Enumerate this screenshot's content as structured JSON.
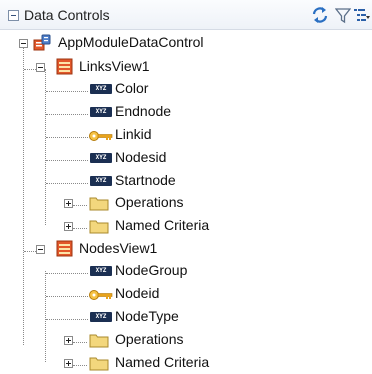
{
  "panel": {
    "title": "Data Controls",
    "toolbar": [
      {
        "name": "refresh-icon",
        "color": "#2a6fc2"
      },
      {
        "name": "filter-icon",
        "color": "#5b6f89"
      },
      {
        "name": "view-options-icon",
        "color": "#2a5fa8"
      }
    ]
  },
  "tree": {
    "root": {
      "label": "AppModuleDataControl",
      "icon": "data-control-icon",
      "expanded": true
    },
    "views": [
      {
        "label": "LinksView1",
        "icon": "view-object-icon",
        "expanded": true,
        "attributes": [
          {
            "label": "Color",
            "icon": "attribute-icon"
          },
          {
            "label": "Endnode",
            "icon": "attribute-icon"
          },
          {
            "label": "Linkid",
            "icon": "key-icon"
          },
          {
            "label": "Nodesid",
            "icon": "attribute-icon"
          },
          {
            "label": "Startnode",
            "icon": "attribute-icon"
          }
        ],
        "folders": [
          {
            "label": "Operations",
            "expanded": false
          },
          {
            "label": "Named Criteria",
            "expanded": false
          }
        ]
      },
      {
        "label": "NodesView1",
        "icon": "view-object-icon",
        "expanded": true,
        "attributes": [
          {
            "label": "NodeGroup",
            "icon": "attribute-icon"
          },
          {
            "label": "Nodeid",
            "icon": "key-icon"
          },
          {
            "label": "NodeType",
            "icon": "attribute-icon"
          }
        ],
        "folders": [
          {
            "label": "Operations",
            "expanded": false
          },
          {
            "label": "Named Criteria",
            "expanded": false
          }
        ]
      }
    ],
    "attribute_badge_text": "XYZ"
  },
  "colors": {
    "header_bg": "#eef2f8",
    "attribute_icon": "#1b2f52",
    "key_icon": "#e8a31c",
    "folder_icon": "#f3d77d",
    "view_icon": "#e2572a"
  }
}
